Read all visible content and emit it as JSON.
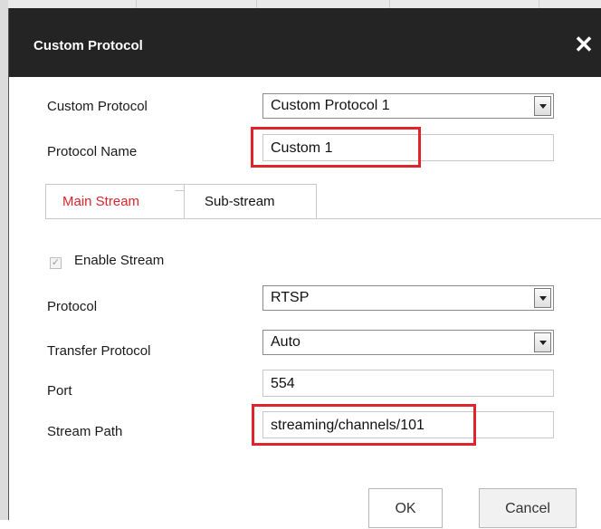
{
  "dialog": {
    "title": "Custom Protocol",
    "close_symbol": "✕"
  },
  "form": {
    "custom_protocol": {
      "label": "Custom Protocol",
      "value": "Custom Protocol 1"
    },
    "protocol_name": {
      "label": "Protocol Name",
      "value": "Custom 1"
    }
  },
  "tabs": [
    {
      "label": "Main Stream",
      "active": true
    },
    {
      "label": "Sub-stream",
      "active": false
    }
  ],
  "stream": {
    "enable": {
      "label": "Enable Stream",
      "checked": true,
      "check_symbol": "✓"
    },
    "protocol": {
      "label": "Protocol",
      "value": "RTSP"
    },
    "transfer_protocol": {
      "label": "Transfer Protocol",
      "value": "Auto"
    },
    "port": {
      "label": "Port",
      "value": "554"
    },
    "stream_path": {
      "label": "Stream Path",
      "value": "streaming/channels/101"
    }
  },
  "buttons": {
    "ok": "OK",
    "cancel": "Cancel"
  },
  "colors": {
    "titlebar": "#242424",
    "active_tab_text": "#d9252c",
    "highlight": "#e0232c"
  }
}
